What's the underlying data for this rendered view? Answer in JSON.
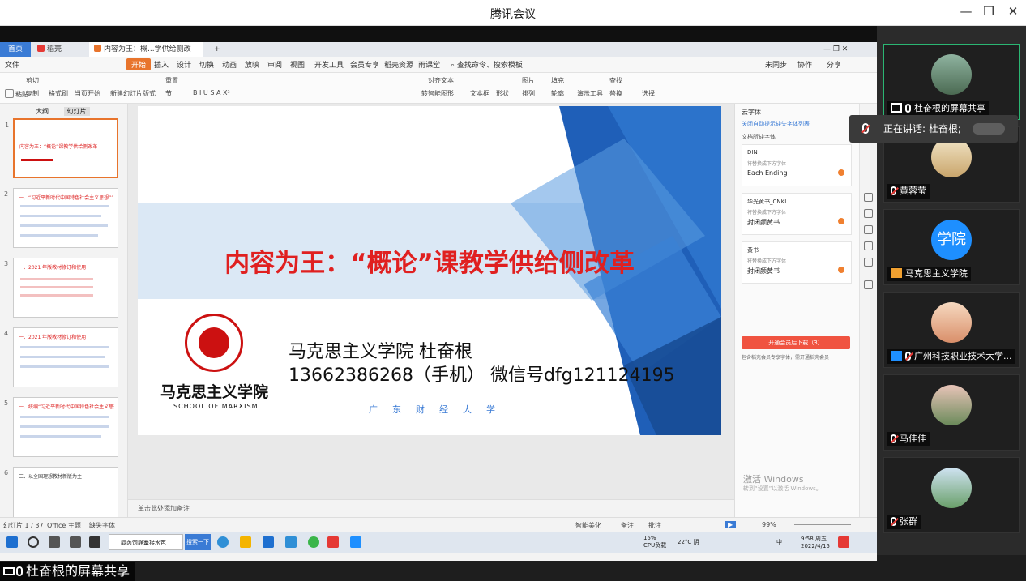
{
  "window": {
    "title": "腾讯会议"
  },
  "wps": {
    "tabs": [
      {
        "label": "首页"
      },
      {
        "label": "稻壳"
      },
      {
        "label": "内容为王：概...学供给侧改革"
      }
    ],
    "menu": [
      "文件",
      "开始",
      "插入",
      "设计",
      "切换",
      "动画",
      "放映",
      "审阅",
      "视图",
      "开发工具",
      "会员专享",
      "稻壳资源",
      "雨课堂"
    ],
    "menu_search": "查找命令、搜索模板",
    "menu_right": [
      "未同步",
      "协作",
      "分享"
    ],
    "ribbon": [
      "粘贴",
      "剪切",
      "复制",
      "格式刷",
      "当页开始",
      "新建幻灯片",
      "版式",
      "节",
      "重置",
      "文本框",
      "形状",
      "排列",
      "图片",
      "轮廓",
      "演示工具",
      "替换",
      "选择",
      "查找",
      "填充",
      "对齐文本",
      "转智能图形"
    ],
    "thumbs_tabs": [
      "大纲",
      "幻灯片"
    ],
    "thumbs": [
      {
        "num": "1",
        "text": "内容为王：“概论”课教学供给侧改革"
      },
      {
        "num": "2",
        "text": "一、“习近平新时代中国特色社会主义思想”” 进入大学思想政治理论课程"
      },
      {
        "num": "3",
        "text": "一、2021 年版教材修订和使用"
      },
      {
        "num": "4",
        "text": "一、2021 年版教材修订和使用"
      },
      {
        "num": "5",
        "text": "一、统编“习近平新时代中国特色社会主义思想”"
      },
      {
        "num": "6",
        "text": "三、以全国理想教材新版为主"
      }
    ],
    "slide": {
      "title": "内容为王：“概论”课教学供给侧改革",
      "author": "马克思主义学院        杜奋根",
      "contact": "13662386268（手机） 微信号dfg121124195",
      "university": "广东财经大学",
      "logo_cn": "马克思主义学院",
      "logo_en": "SCHOOL OF MARXISM"
    },
    "notes_placeholder": "单击此处添加备注",
    "font_panel": {
      "header": "云字体",
      "link": "关闭自动提示缺失字体列表",
      "section": "文档所缺字体",
      "fonts": [
        {
          "name": "DIN",
          "sub": "将替换成下方字体",
          "alt": "Each Ending"
        },
        {
          "name": "华光黄书_CNKI",
          "sub": "将替换成下方字体",
          "alt": "封闭颜黄书"
        },
        {
          "name": "黄书",
          "sub": "将替换成下方字体",
          "alt": "封闭颜黄书"
        }
      ],
      "download_btn": "开通会员后下载（3）",
      "note": "包含稻壳会员专享字体，需开通稻壳会员",
      "activate": "激活 Windows",
      "activate_sub": "转到“设置”以激活 Windows。"
    },
    "status": {
      "slide_count": "幻灯片 1 / 37",
      "theme": "Office 主题",
      "missing_font": "缺失字体",
      "smart": "智能美化",
      "notes": "备注",
      "comments": "批注",
      "zoom": "99%"
    }
  },
  "taskbar": {
    "app": "靛芮饱静篝接水笆",
    "search": "搜索一下",
    "cpu": "15%",
    "cpu_label": "CPU负载",
    "weather": "22°C 阴",
    "lang": "中",
    "time": "9:58 周五",
    "date": "2022/4/15"
  },
  "share_label": "杜奋根的屏幕共享",
  "speaking": "正在讲话: 杜奋根;",
  "participants": [
    {
      "name": "杜奋根的屏幕共享"
    },
    {
      "name": "黄蓉莹"
    },
    {
      "name": "马克思主义学院",
      "avatar_text": "学院"
    },
    {
      "name": "广州科技职业技术大学..."
    },
    {
      "name": "马佳佳"
    },
    {
      "name": "张群"
    }
  ],
  "colors": {
    "accent": "#e8742c",
    "title_red": "#e02020",
    "meeting_green": "#2bb673",
    "blue": "#1e8fff"
  }
}
